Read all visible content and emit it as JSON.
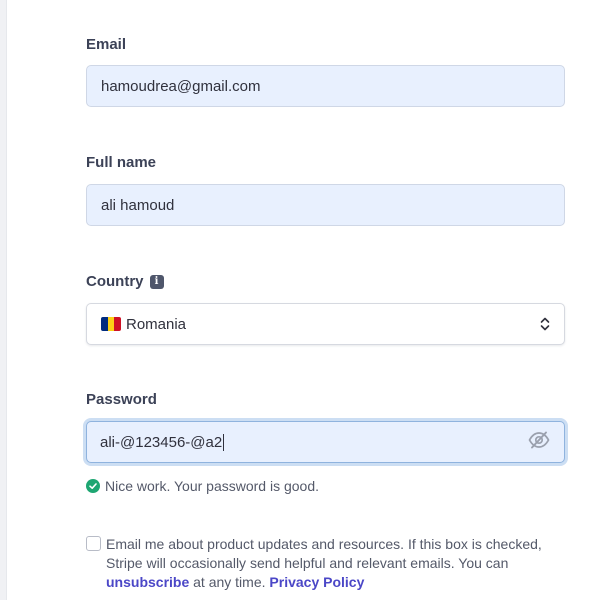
{
  "form": {
    "email": {
      "label": "Email",
      "value": "hamoudrea@gmail.com"
    },
    "full_name": {
      "label": "Full name",
      "value": "ali hamoud"
    },
    "country": {
      "label": "Country",
      "info_icon": "info-icon",
      "value": "Romania",
      "flag_colors": [
        "#002b7f",
        "#fcd116",
        "#ce1126"
      ]
    },
    "password": {
      "label": "Password",
      "value": "ali-@123456-@a2",
      "visibility_icon": "eye-off-icon",
      "hint": "Nice work. Your password is good."
    },
    "consent": {
      "text_before": "Email me about product updates and resources. If this box is checked, Stripe will occasionally send helpful and relevant emails. You can ",
      "unsubscribe_link": "unsubscribe",
      "text_middle": " at any time. ",
      "privacy_link": "Privacy Policy",
      "checked": false
    }
  },
  "colors": {
    "autofill_bg": "#e8f0fe",
    "link": "#4b47c7",
    "success": "#1ea672",
    "label": "#3c4257"
  }
}
